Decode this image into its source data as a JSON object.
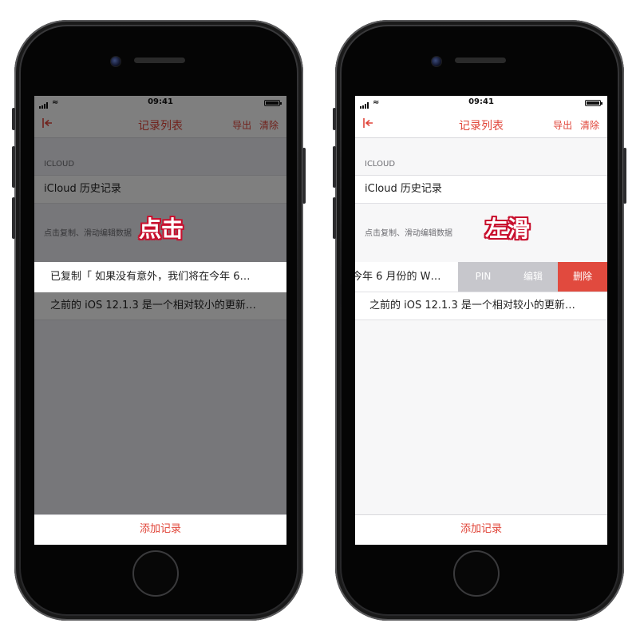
{
  "status": {
    "time": "09:41"
  },
  "nav": {
    "title": "记录列表",
    "export_label": "导出",
    "clear_label": "清除"
  },
  "sections": {
    "icloud_header": "ICLOUD",
    "icloud_row": "iCloud 历史记录",
    "records_header": "点击复制、滑动编辑数据"
  },
  "records": [
    {
      "text": "如果没有意外，我们将在今年 6 月份的 W…"
    },
    {
      "text": "之前的 iOS 12.1.3 是一个相对较小的更新…"
    }
  ],
  "left_screen": {
    "annotation": "点击",
    "toast": "已复制「 如果没有意外，我们将在今年 6…",
    "record_preview": "之前的 iOS 12.1.3 是一个相对较小的更新…"
  },
  "right_screen": {
    "annotation": "左滑",
    "swiped_text": "今年 6 月份的 W…",
    "record_preview": "之前的 iOS 12.1.3 是一个相对较小的更新…",
    "actions": {
      "pin": "PIN",
      "edit": "编辑",
      "delete": "删除"
    }
  },
  "bottom": {
    "add_label": "添加记录"
  },
  "colors": {
    "accent": "#e04438",
    "delete": "#e14a3e",
    "action_gray": "#c7c7cc"
  }
}
